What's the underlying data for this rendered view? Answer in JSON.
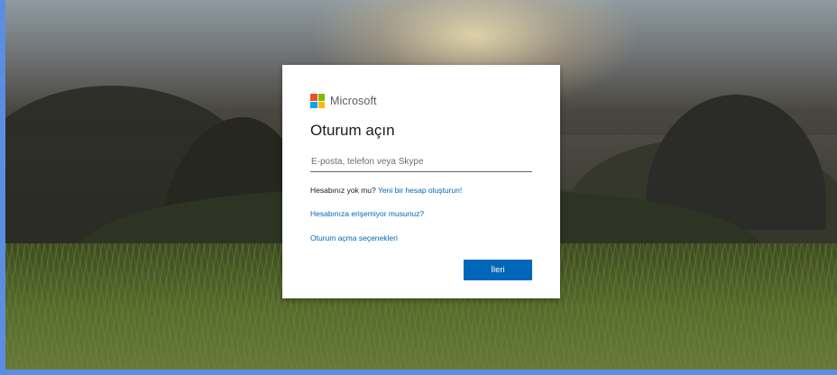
{
  "brand": {
    "name": "Microsoft",
    "logo_colors": [
      "#f25022",
      "#7fba00",
      "#00a4ef",
      "#ffb900"
    ]
  },
  "signin": {
    "title": "Oturum açın",
    "input_value": "",
    "input_placeholder": "E-posta, telefon veya Skype",
    "no_account_text": "Hesabınız yok mu?",
    "create_account_link": "Yeni bir hesap oluşturun!",
    "cant_access_link": "Hesabınıza erişemiyor musunuz?",
    "signin_options_link": "Oturum açma seçenekleri",
    "next_button": "İleri"
  },
  "colors": {
    "accent": "#0067b8",
    "link": "#0067b8",
    "background_border": "#5b8ee0"
  }
}
